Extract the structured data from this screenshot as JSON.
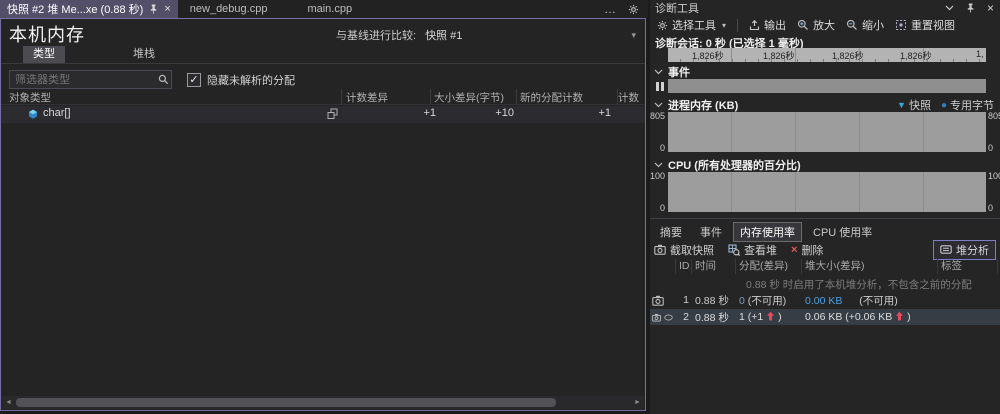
{
  "icons": {
    "close": "×",
    "more": "…",
    "caret": "▾",
    "check": "✓",
    "tri_down": "▼",
    "dot": "●",
    "scroll_left": "◄",
    "scroll_right": "►"
  },
  "colors": {
    "window_accent_border": "#7470a4",
    "active_tab": "#534f68",
    "link_blue": "#4da0e0",
    "increase_red": "#e8485f",
    "legend_blue": "#39a5dc",
    "chart_band_gray": "#9d9d9d"
  },
  "editor": {
    "tabs": [
      {
        "label": "快照 #2 堆 Me...xe (0.88 秒)"
      },
      {
        "label": "new_debug.cpp"
      },
      {
        "label": "main.cpp"
      }
    ],
    "title": "本机内存",
    "baseline": {
      "label": "与基线进行比较:",
      "value": "快照 #1"
    },
    "view_tabs": [
      {
        "label": "类型"
      },
      {
        "label": "堆栈"
      }
    ],
    "filter_placeholder": "筛选器类型",
    "hide_unresolved_label": "隐藏未解析的分配",
    "columns": {
      "type": "对象类型",
      "count_diff": "计数差异",
      "size_diff": "大小差异(字节)",
      "new_alloc": "新的分配计数",
      "count": "计数"
    },
    "rows": [
      {
        "type": "char[]",
        "count_diff": "+1",
        "size_diff": "+10",
        "new_alloc": "+1",
        "count": ""
      }
    ]
  },
  "diagnostics": {
    "title": "诊断工具",
    "toolbar": {
      "select_tool": "选择工具",
      "export": "输出",
      "zoom_in": "放大",
      "zoom_out": "缩小",
      "reset_view": "重置视图"
    },
    "session_label": "诊断会话: 0 秒 (已选择 1 毫秒)",
    "ruler": [
      "1,826秒",
      "1,826秒",
      "1,826秒",
      "1,826秒",
      "1,"
    ],
    "sections": {
      "events": "事件",
      "memory": "进程内存 (KB)",
      "cpu": "CPU (所有处理器的百分比)"
    },
    "memory_legend": {
      "snapshot": "快照",
      "private_bytes": "专用字节"
    },
    "memory_axis": {
      "max": "805",
      "min": "0"
    },
    "cpu_axis": {
      "max": "100",
      "min": "0"
    },
    "tabs": [
      {
        "label": "摘要"
      },
      {
        "label": "事件"
      },
      {
        "label": "内存使用率"
      },
      {
        "label": "CPU 使用率"
      }
    ],
    "snapshot_toolbar": {
      "take_snapshot": "截取快照",
      "view_heap": "查看堆",
      "delete": "删除",
      "heap_analysis": "堆分析"
    },
    "snapshot_table": {
      "columns": {
        "id": "ID",
        "time": "时间",
        "alloc": "分配(差异)",
        "heap": "堆大小(差异)",
        "tags": "标签"
      },
      "notice": "0.88 秒 时启用了本机堆分析，不包含之前的分配",
      "rows": [
        {
          "id": "1",
          "time": "0.88 秒",
          "alloc_value": "0",
          "alloc_note": "(不可用)",
          "heap_link": "0.00 KB",
          "heap_note": "(不可用)"
        },
        {
          "id": "2",
          "time": "0.88 秒",
          "alloc_value": "1 (+1",
          "alloc_close": ")",
          "heap_value": "0.06 KB (+0.06 KB",
          "heap_close": ")"
        }
      ]
    }
  },
  "chart_data": [
    {
      "type": "area",
      "title": "进程内存 (KB)",
      "ylim": [
        0,
        805
      ],
      "series": []
    },
    {
      "type": "area",
      "title": "CPU (所有处理器的百分比)",
      "ylim": [
        0,
        100
      ],
      "series": []
    }
  ]
}
